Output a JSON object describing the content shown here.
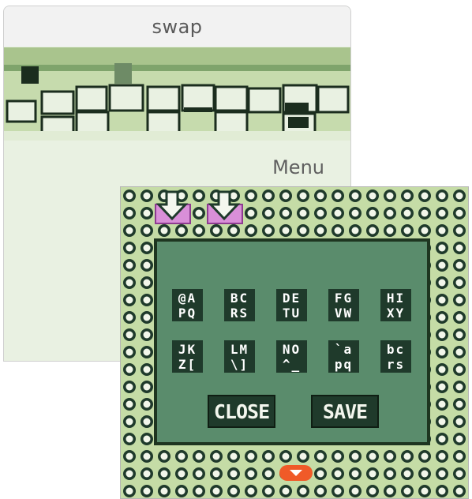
{
  "window": {
    "title": "swap"
  },
  "menu": {
    "label": "Menu"
  },
  "keyboard": {
    "rows": [
      [
        {
          "top": "@A",
          "bottom": "PQ"
        },
        {
          "top": "BC",
          "bottom": "RS"
        },
        {
          "top": "DE",
          "bottom": "TU"
        },
        {
          "top": "FG",
          "bottom": "VW"
        },
        {
          "top": "HI",
          "bottom": "XY"
        }
      ],
      [
        {
          "top": "JK",
          "bottom": "Z["
        },
        {
          "top": "LM",
          "bottom": "\\]"
        },
        {
          "top": "NO",
          "bottom": "^_"
        },
        {
          "top": "`a",
          "bottom": "pq"
        },
        {
          "top": "bc",
          "bottom": "rs"
        }
      ]
    ]
  },
  "buttons": {
    "close": "CLOSE",
    "save": "SAVE"
  },
  "colors": {
    "screen_light": "#c5dca6",
    "screen_dark": "#1f3a2b",
    "box_fill": "#5a8c6c",
    "highlight": "#d98fd8",
    "scroll_indicator": "#f05a28"
  },
  "icons": {
    "slot_arrows": [
      "down-arrow-icon",
      "down-arrow-icon"
    ],
    "scroll": "chevron-down-icon"
  }
}
